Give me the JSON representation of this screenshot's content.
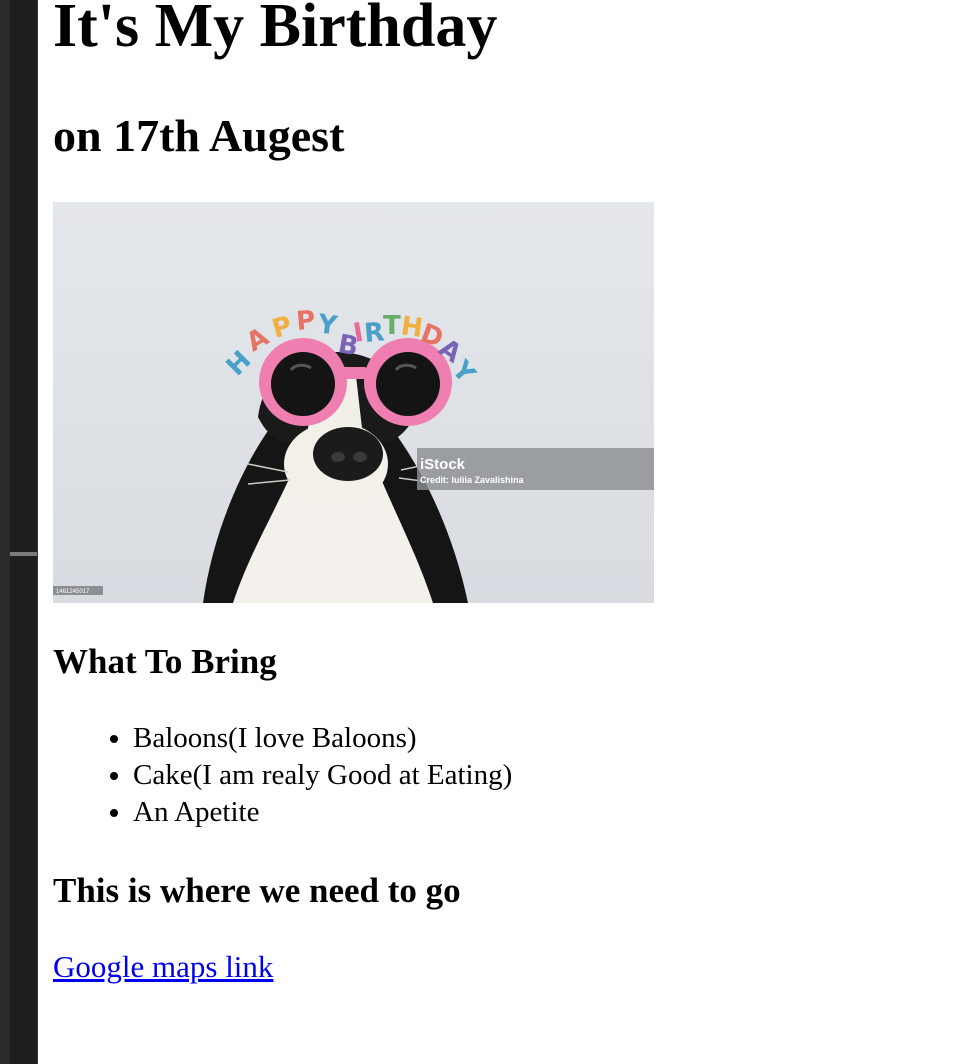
{
  "page": {
    "title": "It's My Birthday",
    "subtitle": "on 17th Augest"
  },
  "photo": {
    "alt_icon": "birthday-dog-photo",
    "glasses_text": "HAPPY BIRTHDAY",
    "watermark_brand": "iStock",
    "watermark_credit": "Credit: Iuliia Zavalishina",
    "stock_id": "1461245017"
  },
  "bring": {
    "heading": "What To Bring",
    "items": [
      "Baloons(I love Baloons)",
      "Cake(I am realy Good at Eating)",
      "An Apetite"
    ]
  },
  "location": {
    "heading": "This is where we need to go",
    "link_text": "Google maps link"
  },
  "colors": {
    "link": "#0000ee",
    "background": "#ffffff",
    "sidebar": "#1e1e1e"
  }
}
